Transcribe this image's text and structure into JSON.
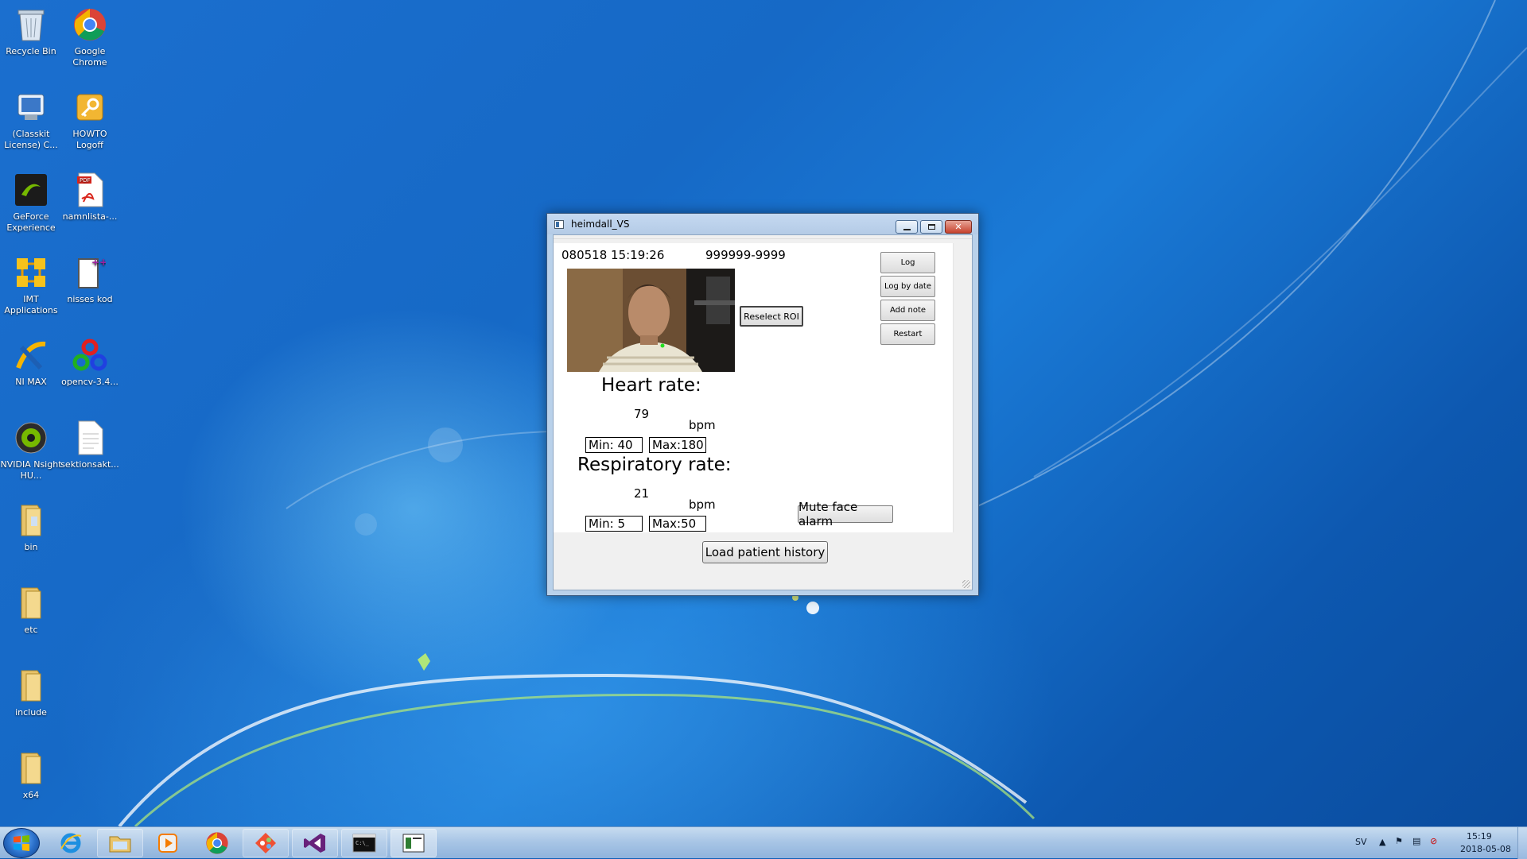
{
  "desktop": {
    "icons": [
      {
        "label": "Recycle Bin"
      },
      {
        "label": "Google Chrome"
      },
      {
        "label": "(Classkit License) C..."
      },
      {
        "label": "HOWTO Logoff"
      },
      {
        "label": "GeForce Experience"
      },
      {
        "label": "namnlista-..."
      },
      {
        "label": "IMT Applications"
      },
      {
        "label": "nisses kod"
      },
      {
        "label": "NI MAX"
      },
      {
        "label": "opencv-3.4..."
      },
      {
        "label": "NVIDIA Nsight HU..."
      },
      {
        "label": "sektionsakt..."
      },
      {
        "label": "bin"
      },
      {
        "label": "etc"
      },
      {
        "label": "include"
      },
      {
        "label": "x64"
      }
    ]
  },
  "window": {
    "title": "heimdall_VS",
    "datetime": "080518 15:19:26",
    "patient_id": "999999-9999",
    "buttons": {
      "reselect_roi": "Reselect ROI",
      "log": "Log",
      "log_by_date": "Log by date",
      "add_note": "Add note",
      "restart": "Restart",
      "mute_face_alarm": "Mute face alarm",
      "load_patient_history": "Load patient history"
    },
    "heart_rate": {
      "title": "Heart rate:",
      "value": "79",
      "unit": "bpm",
      "min_label": "Min: 40",
      "max_label": "Max:180"
    },
    "respiratory_rate": {
      "title": "Respiratory rate:",
      "value": "21",
      "unit": "bpm",
      "min_label": "Min: 5",
      "max_label": "Max:50"
    }
  },
  "taskbar": {
    "apps": [
      "internet-explorer",
      "file-explorer",
      "media-player",
      "google-chrome",
      "git-tool",
      "visual-studio",
      "command-prompt",
      "heimdall-vs"
    ],
    "tray": {
      "language": "SV",
      "time": "15:19",
      "date": "2018-05-08"
    }
  }
}
